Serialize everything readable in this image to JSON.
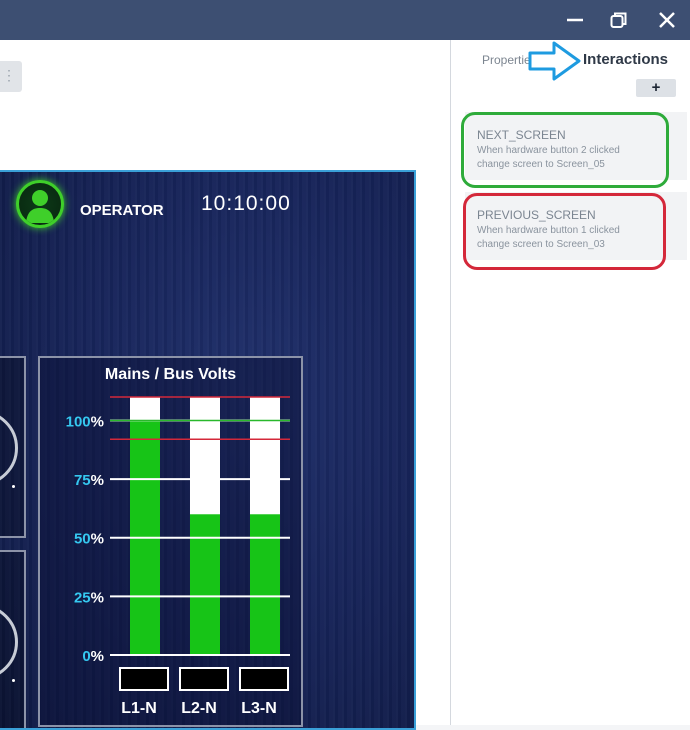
{
  "window": {
    "controls": {
      "minimize": "minimize-icon",
      "restore": "restore-icon",
      "close": "close-icon"
    },
    "titlebar_color": "#3d4f72"
  },
  "hmi": {
    "operator_label": "OPERATOR",
    "clock": "10:10:00",
    "avatar_color": "#3fcf2a"
  },
  "chart_data": {
    "type": "bar",
    "title": "Mains / Bus Volts",
    "categories": [
      "L1-N",
      "L2-N",
      "L3-N"
    ],
    "values": [
      100,
      60,
      60
    ],
    "ylim": [
      0,
      110
    ],
    "yticks": [
      {
        "num": "0",
        "unit": "%",
        "value": 0
      },
      {
        "num": "25",
        "unit": "%",
        "value": 25
      },
      {
        "num": "50",
        "unit": "%",
        "value": 50
      },
      {
        "num": "75",
        "unit": "%",
        "value": 75
      },
      {
        "num": "100",
        "unit": "%",
        "value": 100
      }
    ],
    "limit_lines": [
      {
        "value": 110,
        "color": "#d4283a"
      },
      {
        "value": 100,
        "color": "#29b82b"
      },
      {
        "value": 92,
        "color": "#d4283a"
      }
    ],
    "bar_fill_color": "#17c417",
    "bar_empty_color": "#ffffff",
    "grid": true
  },
  "panel": {
    "tabs": {
      "properties": "Properties",
      "interactions": "Interactions"
    },
    "add_label": "+",
    "interactions": [
      {
        "name": "NEXT_SCREEN",
        "description": "When hardware button 2 clicked change screen to Screen_05"
      },
      {
        "name": "PREVIOUS_SCREEN",
        "description": "When hardware button 1 clicked change screen to Screen_03"
      }
    ]
  }
}
